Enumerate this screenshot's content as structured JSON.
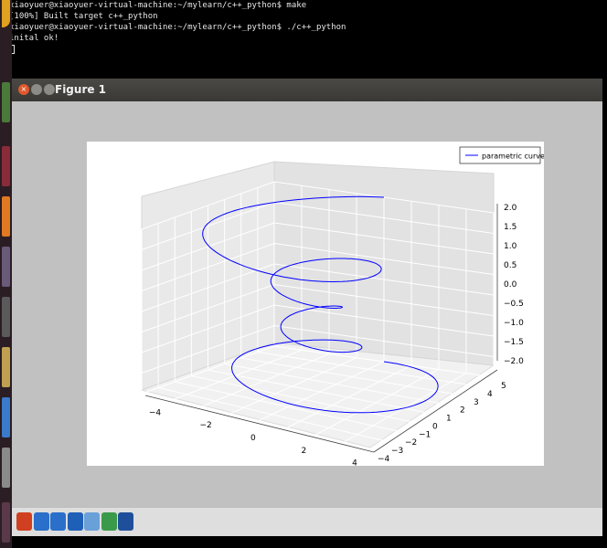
{
  "terminal": {
    "lines": [
      "xiaoyuer@xiaoyuer-virtual-machine:~/mylearn/c++_python$ make",
      "[100%] Built target c++_python",
      "xiaoyuer@xiaoyuer-virtual-machine:~/mylearn/c++_python$ ./c++_python",
      "inital ok!"
    ]
  },
  "window": {
    "title": "Figure 1",
    "close_glyph": "×"
  },
  "toolbar": {
    "tools": [
      {
        "name": "home-icon",
        "color": "#d04020"
      },
      {
        "name": "back-icon",
        "color": "#2a6fc9"
      },
      {
        "name": "forward-icon",
        "color": "#2a6fc9"
      },
      {
        "name": "pan-icon",
        "color": "#1e5fb8"
      },
      {
        "name": "zoom-icon",
        "color": "#6aa0d8"
      },
      {
        "name": "subplots-icon",
        "color": "#3a9a4a"
      },
      {
        "name": "save-icon",
        "color": "#1f4f9a"
      }
    ]
  },
  "colors": {
    "curve": "#0000ff",
    "accent": "#e0582c"
  },
  "chart_data": {
    "type": "line",
    "series": [
      {
        "name": "parametric curve"
      }
    ],
    "legend": {
      "placement": "top-right",
      "entries": [
        "parametric curve"
      ]
    },
    "x_ticks": [
      "−4",
      "−2",
      "0",
      "2",
      "4"
    ],
    "y_ticks": [
      "−4",
      "−3",
      "−2",
      "−1",
      "0",
      "1",
      "2",
      "3",
      "4",
      "5"
    ],
    "z_ticks": [
      "−2.0",
      "−1.5",
      "−1.0",
      "−0.5",
      "0.0",
      "0.5",
      "1.0",
      "1.5",
      "2.0"
    ],
    "xlim": [
      -4.5,
      4.5
    ],
    "ylim": [
      -4,
      5
    ],
    "zlim": [
      -2,
      2
    ],
    "grid": true
  }
}
